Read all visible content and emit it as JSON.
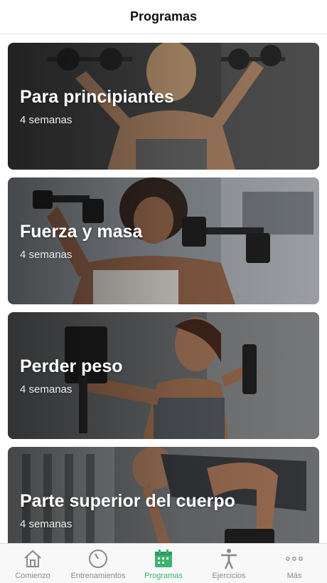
{
  "header": {
    "title": "Programas"
  },
  "programs": [
    {
      "title": "Para principiantes",
      "duration": "4 semanas"
    },
    {
      "title": "Fuerza y masa",
      "duration": "4 semanas"
    },
    {
      "title": "Perder peso",
      "duration": "4 semanas"
    },
    {
      "title": "Parte superior del cuerpo",
      "duration": "4 semanas"
    }
  ],
  "tabs": [
    {
      "label": "Comienzo",
      "icon": "home-icon"
    },
    {
      "label": "Entrenamientos",
      "icon": "timer-icon"
    },
    {
      "label": "Programas",
      "icon": "calendar-icon",
      "active": true
    },
    {
      "label": "Ejercicios",
      "icon": "person-icon"
    },
    {
      "label": "Más",
      "icon": "more-icon"
    }
  ],
  "colors": {
    "accent": "#3cb371",
    "inactive": "#8a8a8a"
  }
}
